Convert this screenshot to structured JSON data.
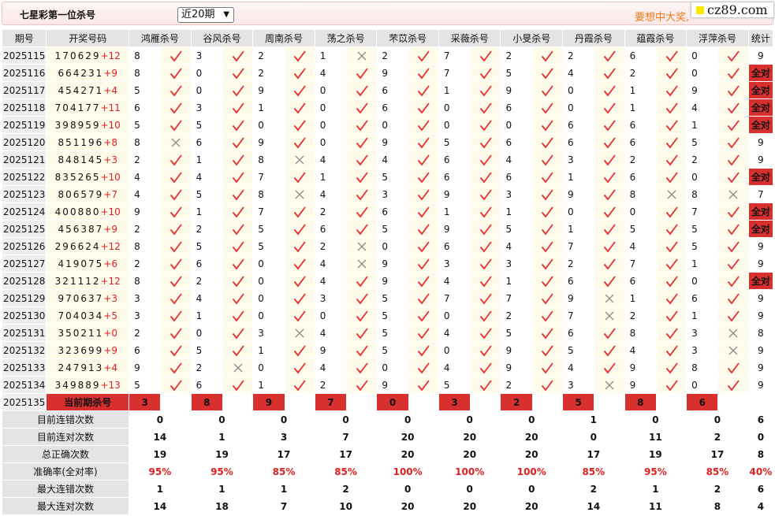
{
  "header": {
    "title": "七星彩第一位杀号",
    "period_select": "近20期",
    "slogan": "要想中大奖,",
    "site_badge": "cz89.com"
  },
  "table": {
    "head": [
      "期号",
      "开奖号码",
      "鸿雁杀号",
      "谷风杀号",
      "周南杀号",
      "荡之杀号",
      "芣苡杀号",
      "采薇杀号",
      "小旻杀号",
      "丹霞杀号",
      "蕴霞杀号",
      "浮萍杀号",
      "统计"
    ],
    "rows": [
      {
        "period": "2025115",
        "digits": "170629",
        "sum": "+12",
        "picks": [
          8,
          3,
          2,
          1,
          2,
          7,
          2,
          2,
          6,
          0
        ],
        "marks": [
          1,
          1,
          1,
          0,
          1,
          1,
          1,
          1,
          1,
          1
        ],
        "stat": "9"
      },
      {
        "period": "2025116",
        "digits": "664231",
        "sum": "+9",
        "picks": [
          8,
          0,
          2,
          4,
          9,
          7,
          5,
          4,
          2,
          0
        ],
        "marks": [
          1,
          1,
          1,
          1,
          1,
          1,
          1,
          1,
          1,
          1
        ],
        "stat": "全对"
      },
      {
        "period": "2025117",
        "digits": "454271",
        "sum": "+4",
        "picks": [
          5,
          0,
          9,
          0,
          6,
          1,
          9,
          0,
          1,
          9
        ],
        "marks": [
          1,
          1,
          1,
          1,
          1,
          1,
          1,
          1,
          1,
          1
        ],
        "stat": "全对"
      },
      {
        "period": "2025118",
        "digits": "704177",
        "sum": "+11",
        "picks": [
          6,
          3,
          1,
          0,
          6,
          0,
          6,
          0,
          1,
          4
        ],
        "marks": [
          1,
          1,
          1,
          1,
          1,
          1,
          1,
          1,
          1,
          1
        ],
        "stat": "全对"
      },
      {
        "period": "2025119",
        "digits": "398959",
        "sum": "+10",
        "picks": [
          5,
          5,
          0,
          0,
          0,
          0,
          0,
          6,
          6,
          1
        ],
        "marks": [
          1,
          1,
          1,
          1,
          1,
          1,
          1,
          1,
          1,
          1
        ],
        "stat": "全对"
      },
      {
        "period": "2025120",
        "digits": "851196",
        "sum": "+8",
        "picks": [
          8,
          6,
          9,
          0,
          9,
          5,
          6,
          6,
          6,
          5
        ],
        "marks": [
          0,
          1,
          1,
          1,
          1,
          1,
          1,
          1,
          1,
          1
        ],
        "stat": "9"
      },
      {
        "period": "2025121",
        "digits": "848145",
        "sum": "+3",
        "picks": [
          2,
          1,
          8,
          4,
          4,
          6,
          4,
          3,
          2,
          2
        ],
        "marks": [
          1,
          1,
          0,
          1,
          1,
          1,
          1,
          1,
          1,
          1
        ],
        "stat": "9"
      },
      {
        "period": "2025122",
        "digits": "835265",
        "sum": "+10",
        "picks": [
          4,
          4,
          7,
          1,
          5,
          6,
          6,
          1,
          6,
          0
        ],
        "marks": [
          1,
          1,
          1,
          1,
          1,
          1,
          1,
          1,
          1,
          1
        ],
        "stat": "全对"
      },
      {
        "period": "2025123",
        "digits": "806579",
        "sum": "+7",
        "picks": [
          4,
          5,
          8,
          4,
          3,
          9,
          3,
          9,
          8,
          8
        ],
        "marks": [
          1,
          1,
          0,
          1,
          1,
          1,
          1,
          1,
          0,
          0
        ],
        "stat": "7"
      },
      {
        "period": "2025124",
        "digits": "400880",
        "sum": "+10",
        "picks": [
          9,
          1,
          7,
          2,
          6,
          1,
          1,
          0,
          0,
          7
        ],
        "marks": [
          1,
          1,
          1,
          1,
          1,
          1,
          1,
          1,
          1,
          1
        ],
        "stat": "全对"
      },
      {
        "period": "2025125",
        "digits": "456387",
        "sum": "+9",
        "picks": [
          2,
          2,
          5,
          6,
          5,
          9,
          5,
          1,
          5,
          5
        ],
        "marks": [
          1,
          1,
          1,
          1,
          1,
          1,
          1,
          1,
          1,
          1
        ],
        "stat": "全对"
      },
      {
        "period": "2025126",
        "digits": "296624",
        "sum": "+12",
        "picks": [
          8,
          5,
          5,
          2,
          0,
          6,
          4,
          7,
          4,
          5
        ],
        "marks": [
          1,
          1,
          1,
          0,
          1,
          1,
          1,
          1,
          1,
          1
        ],
        "stat": "9"
      },
      {
        "period": "2025127",
        "digits": "419075",
        "sum": "+6",
        "picks": [
          2,
          6,
          0,
          4,
          9,
          3,
          3,
          2,
          7,
          1
        ],
        "marks": [
          1,
          1,
          1,
          0,
          1,
          1,
          1,
          1,
          1,
          1
        ],
        "stat": "9"
      },
      {
        "period": "2025128",
        "digits": "321112",
        "sum": "+12",
        "picks": [
          8,
          2,
          0,
          4,
          9,
          4,
          1,
          6,
          6,
          0
        ],
        "marks": [
          1,
          1,
          1,
          1,
          1,
          1,
          1,
          1,
          1,
          1
        ],
        "stat": "全对"
      },
      {
        "period": "2025129",
        "digits": "970637",
        "sum": "+3",
        "picks": [
          3,
          4,
          0,
          3,
          5,
          7,
          7,
          9,
          1,
          6
        ],
        "marks": [
          1,
          1,
          1,
          1,
          1,
          1,
          1,
          0,
          1,
          1
        ],
        "stat": "9"
      },
      {
        "period": "2025130",
        "digits": "704034",
        "sum": "+5",
        "picks": [
          3,
          1,
          0,
          0,
          5,
          0,
          2,
          7,
          2,
          1
        ],
        "marks": [
          1,
          1,
          1,
          1,
          1,
          1,
          1,
          0,
          1,
          1
        ],
        "stat": "9"
      },
      {
        "period": "2025131",
        "digits": "350211",
        "sum": "+0",
        "picks": [
          2,
          0,
          3,
          4,
          5,
          4,
          5,
          6,
          8,
          3
        ],
        "marks": [
          1,
          1,
          0,
          1,
          1,
          1,
          1,
          1,
          1,
          0
        ],
        "stat": "8"
      },
      {
        "period": "2025132",
        "digits": "323699",
        "sum": "+9",
        "picks": [
          6,
          5,
          1,
          9,
          5,
          0,
          9,
          5,
          4,
          3
        ],
        "marks": [
          1,
          1,
          1,
          1,
          1,
          1,
          1,
          1,
          1,
          0
        ],
        "stat": "9"
      },
      {
        "period": "2025133",
        "digits": "247913",
        "sum": "+4",
        "picks": [
          9,
          2,
          0,
          4,
          0,
          4,
          9,
          4,
          9,
          8
        ],
        "marks": [
          1,
          0,
          1,
          1,
          1,
          1,
          1,
          1,
          1,
          1
        ],
        "stat": "9"
      },
      {
        "period": "2025134",
        "digits": "349889",
        "sum": "+13",
        "picks": [
          5,
          6,
          1,
          2,
          9,
          5,
          2,
          3,
          9,
          0
        ],
        "marks": [
          1,
          1,
          1,
          1,
          1,
          1,
          1,
          0,
          1,
          1
        ],
        "stat": "9"
      }
    ],
    "current": {
      "period": "2025135",
      "label": "当前期杀号",
      "picks": [
        "3",
        "8",
        "9",
        "7",
        "0",
        "3",
        "2",
        "5",
        "8",
        "6"
      ]
    },
    "summary": [
      {
        "label": "目前连错次数",
        "values": [
          "0",
          "0",
          "0",
          "0",
          "0",
          "0",
          "0",
          "1",
          "0",
          "0",
          "6"
        ],
        "red": false
      },
      {
        "label": "目前连对次数",
        "values": [
          "14",
          "1",
          "3",
          "7",
          "20",
          "20",
          "20",
          "0",
          "11",
          "2",
          "0"
        ],
        "red": false
      },
      {
        "label": "总正确次数",
        "values": [
          "19",
          "19",
          "17",
          "17",
          "20",
          "20",
          "20",
          "17",
          "19",
          "17",
          "8"
        ],
        "red": false
      },
      {
        "label": "准确率(全对率)",
        "values": [
          "95%",
          "95%",
          "85%",
          "85%",
          "100%",
          "100%",
          "100%",
          "85%",
          "95%",
          "85%",
          "40%"
        ],
        "red": true
      },
      {
        "label": "最大连错次数",
        "values": [
          "1",
          "1",
          "1",
          "2",
          "0",
          "0",
          "0",
          "2",
          "1",
          "2",
          "6"
        ],
        "red": false
      },
      {
        "label": "最大连对次数",
        "values": [
          "14",
          "18",
          "7",
          "10",
          "20",
          "20",
          "20",
          "14",
          "11",
          "8",
          "4"
        ],
        "red": false
      }
    ]
  },
  "colors": {
    "accent": "#d8302e",
    "value_blue": "#1440c8",
    "check_red": "#e83030",
    "cross_gray": "#8a8a8a",
    "slogan": "#ee7a1a"
  },
  "icons": {
    "correct": "check-icon",
    "wrong": "cross-icon"
  }
}
